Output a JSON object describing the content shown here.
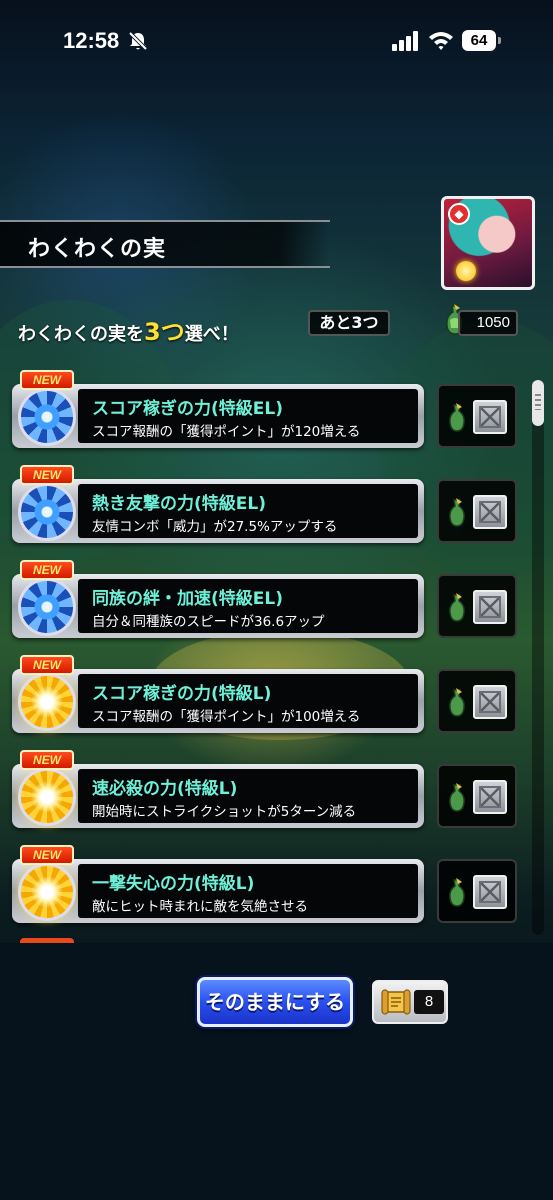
{
  "status_bar": {
    "time": "12:58",
    "battery": "64"
  },
  "header": {
    "title": "わくわくの実"
  },
  "instruction": {
    "prefix": "わくわくの実を",
    "highlight": "3つ",
    "suffix": "選べ！",
    "remaining": "あと3つ",
    "points": "1050"
  },
  "fruits": [
    {
      "badge": "NEW",
      "name": "スコア稼ぎの力(特級EL)",
      "description": "スコア報酬の「獲得ポイント」が120増える",
      "orb": "blue-orb-icon"
    },
    {
      "badge": "NEW",
      "name": "熱き友撃の力(特級EL)",
      "description": "友情コンボ「威力」が27.5%アップする",
      "orb": "blue-orb-icon"
    },
    {
      "badge": "NEW",
      "name": "同族の絆・加速(特級EL)",
      "description": "自分＆同種族のスピードが36.6アップ",
      "orb": "blue-orb-icon"
    },
    {
      "badge": "NEW",
      "name": "スコア稼ぎの力(特級L)",
      "description": "スコア報酬の「獲得ポイント」が100増える",
      "orb": "gold-orb-icon"
    },
    {
      "badge": "NEW",
      "name": "速必殺の力(特級L)",
      "description": "開始時にストライクショットが5ターン減る",
      "orb": "gold-orb-icon"
    },
    {
      "badge": "NEW",
      "name": "一撃失心の力(特級L)",
      "description": "敵にヒット時まれに敵を気絶させる",
      "orb": "gold-orb-icon"
    }
  ],
  "footer": {
    "keep_label": "そのままにする",
    "ticket_count": "8"
  },
  "colors": {
    "fruit_name": "#6ff0d8",
    "highlight": "#ffe033",
    "keep_button": "#2a4ff0",
    "new_badge": "#e82a0a"
  }
}
